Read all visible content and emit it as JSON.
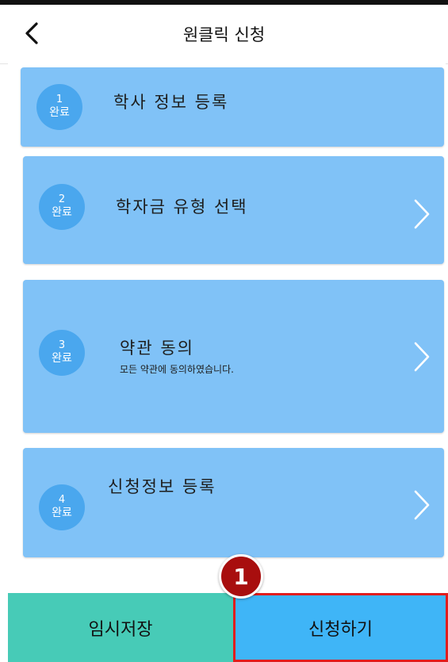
{
  "header": {
    "title": "원클릭 신청"
  },
  "steps": [
    {
      "number": "1",
      "status": "완료",
      "title": "학사 정보 등록",
      "subtitle": ""
    },
    {
      "number": "2",
      "status": "완료",
      "title": "학자금 유형 선택",
      "subtitle": ""
    },
    {
      "number": "3",
      "status": "완료",
      "title": "약관 동의",
      "subtitle": "모든 약관에 동의하였습니다."
    },
    {
      "number": "4",
      "status": "완료",
      "title": "신청정보 등록",
      "subtitle": ""
    }
  ],
  "footer": {
    "save_label": "임시저장",
    "apply_label": "신청하기"
  },
  "annotation": {
    "marker": "1"
  },
  "colors": {
    "card": "#80c2f7",
    "circle": "#4aa7ee",
    "save_button": "#47cbb7",
    "apply_button": "#3fb5f7",
    "highlight": "#e11d1d",
    "marker": "#a80e0e"
  }
}
